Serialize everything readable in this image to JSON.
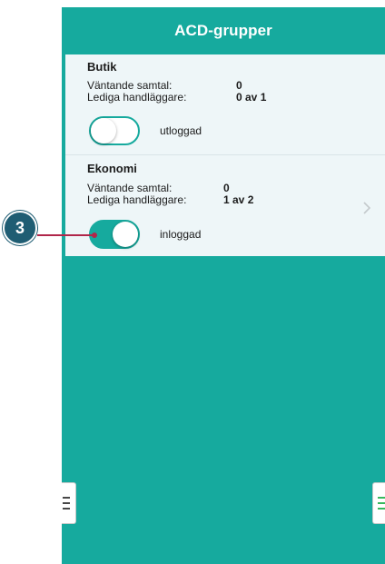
{
  "header": {
    "title": "ACD-grupper"
  },
  "groups": [
    {
      "name": "Butik",
      "waiting_label": "Väntande samtal:",
      "waiting_value": "0",
      "available_label": "Lediga handläggare:",
      "available_value": "0 av 1",
      "toggle_state": "off",
      "toggle_label": "utloggad"
    },
    {
      "name": "Ekonomi",
      "waiting_label": "Väntande samtal:",
      "waiting_value": "0",
      "available_label": "Lediga handläggare:",
      "available_value": "1 av 2",
      "toggle_state": "on",
      "toggle_label": "inloggad"
    }
  ],
  "callout": {
    "number": "3"
  },
  "icons": {
    "left_tab": "menu-icon",
    "right_tab": "menu-icon",
    "row_chevron": "chevron-right-icon"
  },
  "colors": {
    "accent": "#16aa9e",
    "list_background": "#eef6f8",
    "callout": "#1f5d73",
    "callout_line": "#b0264a",
    "right_menu_icon": "#22b14c"
  }
}
